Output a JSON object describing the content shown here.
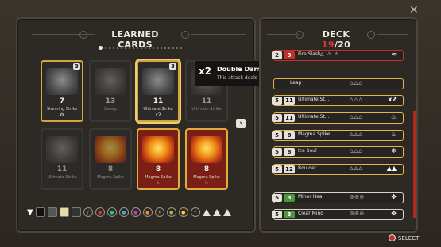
{
  "learned": {
    "title": "LEARNED CARDS"
  },
  "cards": [
    {
      "cost": "3",
      "value": "7",
      "name": "Stunning Strike",
      "icon": "⚙"
    },
    {
      "value": "13",
      "name": "Sweep"
    },
    {
      "cost": "3",
      "value": "11",
      "name": "Ultimate Strike",
      "icon": "x2"
    },
    {
      "value": "11",
      "name": "Ultimate Strike"
    },
    {
      "value": "11",
      "name": "Ultimate Strike"
    },
    {
      "value": "8",
      "name": "Magma Spike"
    },
    {
      "value": "8",
      "name": "Magma Spike",
      "icon": "♨"
    },
    {
      "value": "8",
      "name": "Magma Spike",
      "icon": "♨"
    }
  ],
  "tooltip": {
    "badge": "x2",
    "title": "Double Damage",
    "desc": "This attack deals double damage."
  },
  "deck": {
    "title": "DECK",
    "count": "19",
    "max": "/20",
    "rows": [
      {
        "cost": "2",
        "count": "9",
        "name": "Fire Slash",
        "icons": "△ ⚠ ⚠",
        "tag": "∞"
      },
      {
        "name": "Leap",
        "icons": "△△△"
      },
      {
        "cost": "5",
        "count": "11",
        "name": "Ultimate St...",
        "icons": "△△△",
        "tag": "x2"
      },
      {
        "cost": "5",
        "count": "11",
        "name": "Ultimate St...",
        "icons": "△△△",
        "tag": "♨"
      },
      {
        "cost": "5",
        "count": "8",
        "name": "Magma Spike",
        "icons": "△△△",
        "tag": "♨"
      },
      {
        "cost": "5",
        "count": "8",
        "name": "Ice Soul",
        "icons": "△△△",
        "tag": "❄"
      },
      {
        "cost": "5",
        "count": "12",
        "name": "Boulder",
        "icons": "△△△",
        "tag": "▲▲"
      },
      {
        "cost": "5",
        "count": "3",
        "name": "Minor Heal",
        "icons": "◎◎◎",
        "tag": "✥"
      },
      {
        "cost": "5",
        "count": "3",
        "name": "Clear Mind",
        "icons": "◎◎◎",
        "tag": "✥"
      }
    ]
  },
  "hint": {
    "select": "SELECT"
  },
  "colors": {
    "gold": "#d5a53a",
    "red": "#c43028",
    "panel": "#2d2a26"
  }
}
